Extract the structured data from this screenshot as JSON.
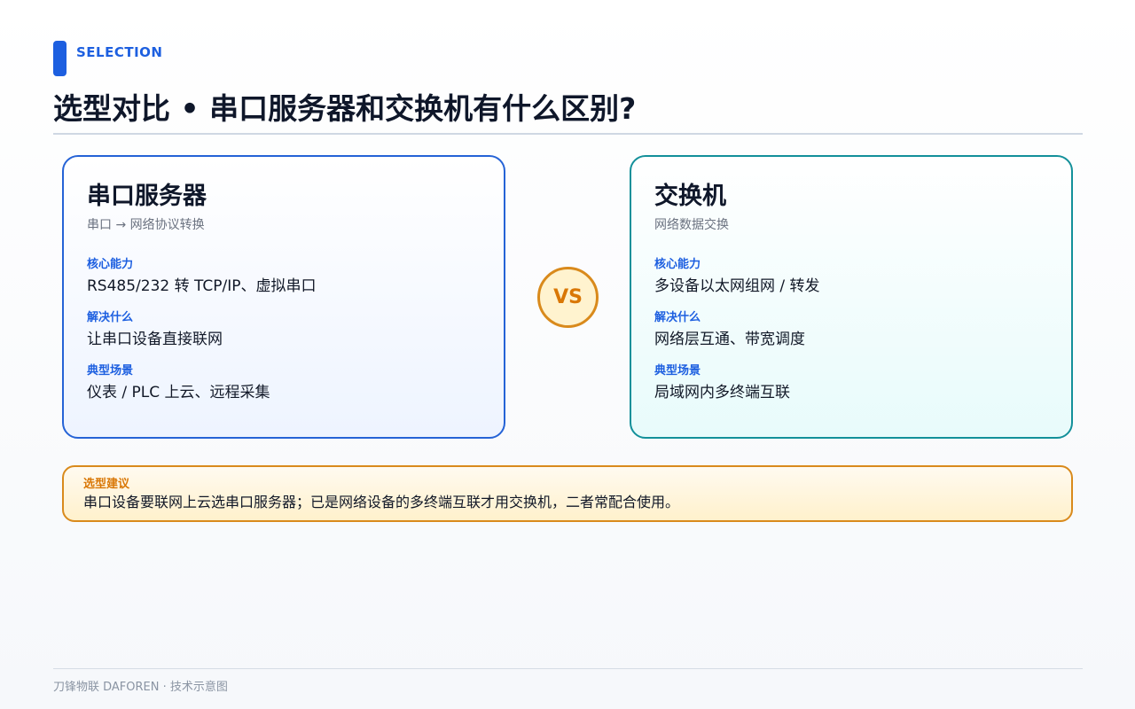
{
  "header": {
    "eyebrow": "SELECTION",
    "title": "选型对比 • 串口服务器和交换机有什么区别?"
  },
  "cards": [
    {
      "title": "串口服务器",
      "subtitle": "串口 → 网络协议转换",
      "fields": [
        {
          "label": "核心能力",
          "value": "RS485/232 转 TCP/IP、虚拟串口"
        },
        {
          "label": "解决什么",
          "value": "让串口设备直接联网"
        },
        {
          "label": "典型场景",
          "value": "仪表 / PLC 上云、远程采集"
        }
      ]
    },
    {
      "title": "交换机",
      "subtitle": "网络数据交换",
      "fields": [
        {
          "label": "核心能力",
          "value": "多设备以太网组网 / 转发"
        },
        {
          "label": "解决什么",
          "value": "网络层互通、带宽调度"
        },
        {
          "label": "典型场景",
          "value": "局域网内多终端互联"
        }
      ]
    }
  ],
  "vs_label": "VS",
  "advice": {
    "label": "选型建议",
    "text": "串口设备要联网上云选串口服务器；已是网络设备的多终端互联才用交换机，二者常配合使用。"
  },
  "footer": {
    "text": "刀锋物联 DAFOREN · 技术示意图"
  },
  "colors": {
    "accent_blue": "#1d5fe0",
    "accent_teal": "#13909a",
    "accent_orange": "#d97706"
  }
}
